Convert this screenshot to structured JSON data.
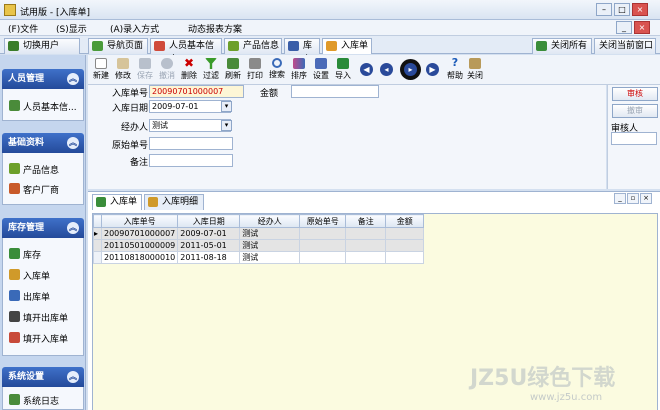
{
  "window": {
    "title": "试用版 - [入库单]"
  },
  "menu": {
    "file": "(F)文件",
    "display": "(S)显示",
    "entry_mode": "(A)录入方式",
    "dynamic_report": "动态报表方案"
  },
  "doc_tabs": {
    "switch_user": "切换用户",
    "items": [
      "导航页面",
      "人员基本信息",
      "产品信息",
      "库存",
      "入库单"
    ],
    "close_all": "关闭所有",
    "close_current": "关闭当前窗口"
  },
  "sidebar": {
    "sections": [
      {
        "title": "人员管理",
        "items": [
          "人员基本信..."
        ]
      },
      {
        "title": "基础资料",
        "items": [
          "产品信息",
          "客户厂商"
        ]
      },
      {
        "title": "库存管理",
        "items": [
          "库存",
          "入库单",
          "出库单",
          "填开出库单",
          "填开入库单"
        ]
      },
      {
        "title": "系统设置",
        "items": [
          "系统日志"
        ]
      }
    ]
  },
  "toolbar": {
    "new": "新建",
    "edit": "修改",
    "save": "保存",
    "cancel": "撤消",
    "delete": "删除",
    "filter": "过滤",
    "refresh": "刷新",
    "print": "打印",
    "search": "搜索",
    "sort": "排序",
    "settings": "设置",
    "import": "导入",
    "help": "帮助",
    "close": "关闭",
    "first_icon": "first-record-icon",
    "prev_icon": "prev-record-icon",
    "next_icon": "next-record-icon",
    "last_icon": "last-record-icon"
  },
  "form": {
    "labels": {
      "receipt_no": "入库单号",
      "date": "入库日期",
      "handler": "经办人",
      "orig_no": "原始单号",
      "note": "备注",
      "amount": "金额"
    },
    "values": {
      "receipt_no": "20090701000007",
      "date": "2009-07-01",
      "handler": "测试",
      "orig_no": "",
      "note": "",
      "amount": ""
    }
  },
  "right_panel": {
    "approve": "审核",
    "unapprove": "撤审",
    "approver_label": "审核人"
  },
  "subtabs": [
    "入库单",
    "入库明细"
  ],
  "grid": {
    "columns": [
      "入库单号",
      "入库日期",
      "经办人",
      "原始单号",
      "备注",
      "金额"
    ],
    "rows": [
      [
        "20090701000007",
        "2009-07-01",
        "测试",
        "",
        "",
        ""
      ],
      [
        "20110501000009",
        "2011-05-01",
        "测试",
        "",
        "",
        ""
      ],
      [
        "20110818000010",
        "2011-08-18",
        "测试",
        "",
        "",
        ""
      ]
    ]
  },
  "watermark": {
    "text": "JZ5U绿色下载",
    "url": "www.jz5u.com"
  },
  "colors": {
    "accent": "#244a9a",
    "grid_bg": "#fbfbe0",
    "highlight_red": "#cc0000"
  }
}
